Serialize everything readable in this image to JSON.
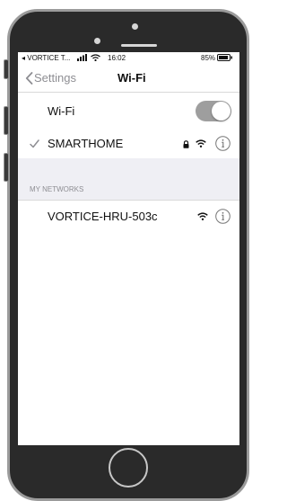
{
  "status_bar": {
    "carrier": "◂ VORTICE T...",
    "time": "16:02",
    "battery": "85%",
    "signal_icon": "signal-bars-icon",
    "wifi_icon": "wifi-icon",
    "battery_icon": "battery-icon"
  },
  "nav": {
    "back_label": "Settings",
    "title": "Wi-Fi"
  },
  "wifi_toggle": {
    "label": "Wi-Fi",
    "state": "on",
    "track_color": "#9e9e9e"
  },
  "connected_network": {
    "name": "SMARTHOME",
    "secured": true
  },
  "section_header": "MY NETWORKS",
  "networks": [
    {
      "name": "VORTICE-HRU-503c",
      "secured": false
    }
  ],
  "colors": {
    "accent": "#8e8e93",
    "section_background": "#efeff4",
    "bezel": "#2a2a2a"
  }
}
